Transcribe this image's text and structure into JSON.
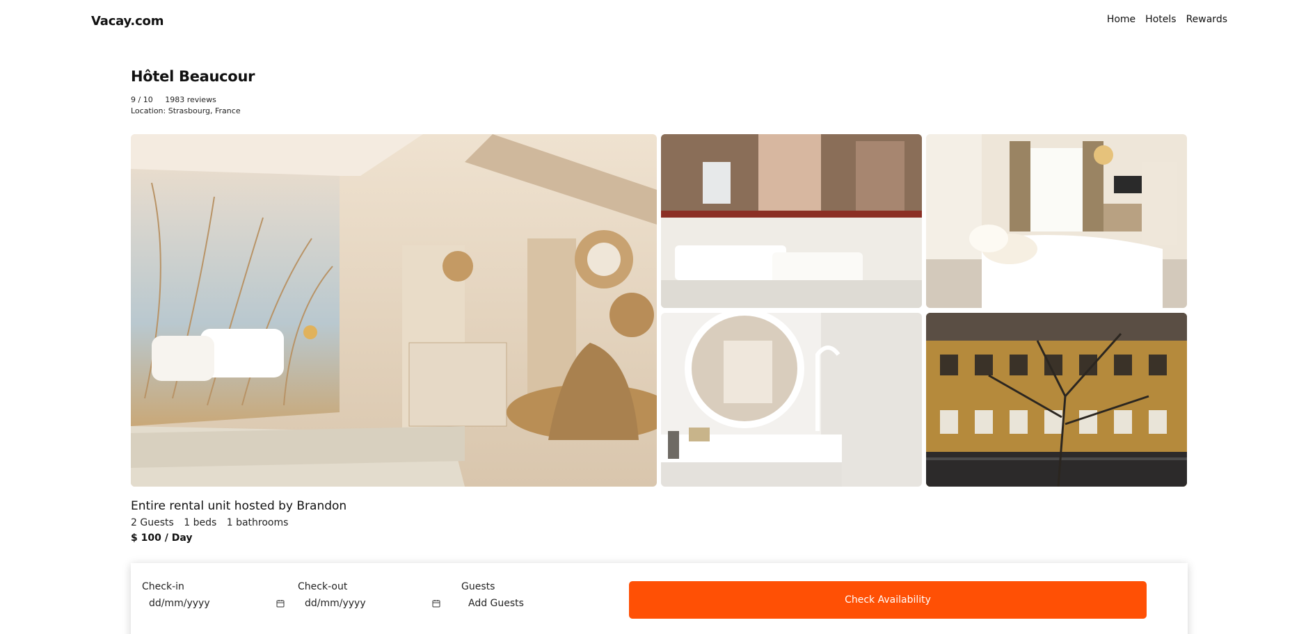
{
  "brand": {
    "logo": "Vacay.com"
  },
  "nav": {
    "items": [
      "Home",
      "Hotels",
      "Rewards"
    ]
  },
  "hotel": {
    "name": "Hôtel Beaucour",
    "rating": "9 / 10",
    "reviews": "1983 reviews",
    "location": "Location: Strasbourg, France"
  },
  "gallery": {
    "photos": [
      {
        "name": "bedroom-beach-mural-photo"
      },
      {
        "name": "bathroom-tub-photo"
      },
      {
        "name": "bedroom-window-photo"
      },
      {
        "name": "bathroom-round-mirror-photo"
      },
      {
        "name": "hotel-facade-photo"
      }
    ]
  },
  "listing": {
    "title": "Entire rental unit hosted by Brandon",
    "guests": "2 Guests",
    "beds": "1 beds",
    "bathrooms": "1 bathrooms",
    "price": "$ 100 / Day"
  },
  "booking": {
    "checkin_label": "Check-in",
    "checkin_placeholder": "dd/mm/yyyy",
    "checkout_label": "Check-out",
    "checkout_placeholder": "dd/mm/yyyy",
    "guests_label": "Guests",
    "guests_placeholder": "Add Guests",
    "button_label": "Check Availability",
    "accent": "#ff5005"
  }
}
